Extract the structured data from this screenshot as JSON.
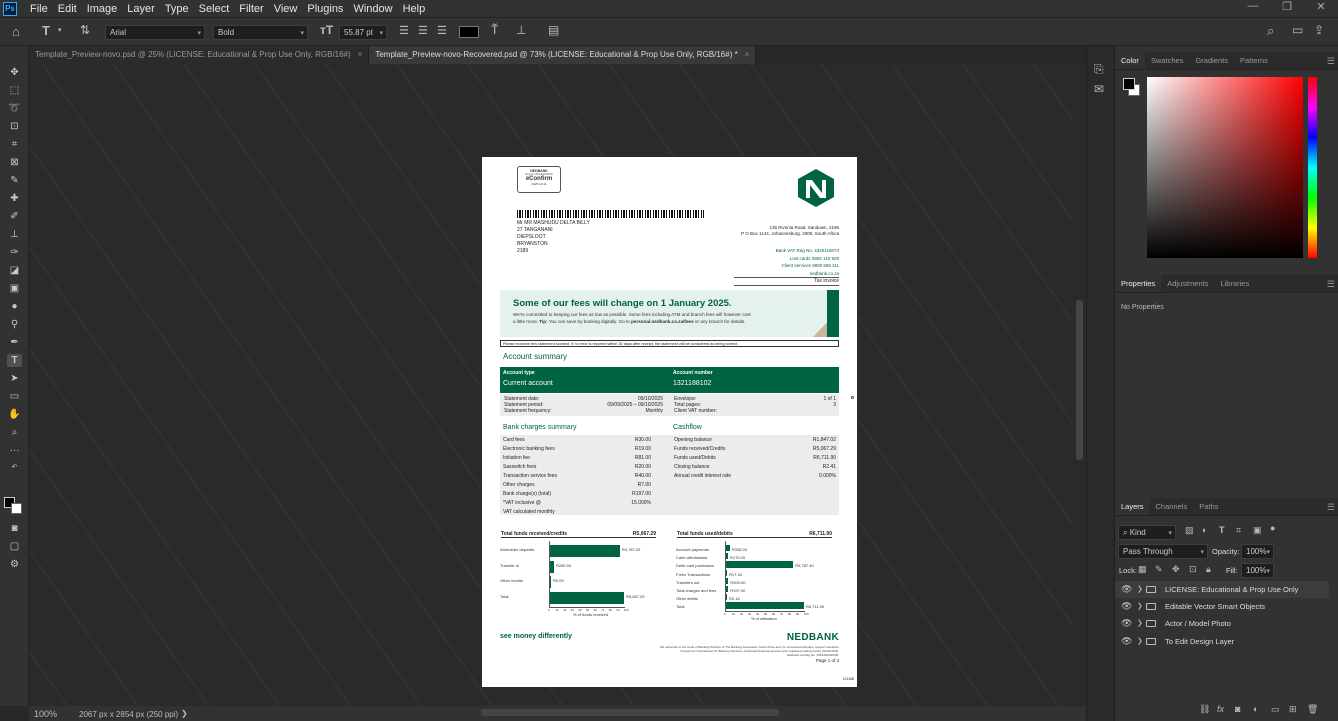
{
  "app": {
    "logo": "Ps"
  },
  "menu": [
    "File",
    "Edit",
    "Image",
    "Layer",
    "Type",
    "Select",
    "Filter",
    "View",
    "Plugins",
    "Window",
    "Help"
  ],
  "options": {
    "font_family": "Arial",
    "font_style": "Bold",
    "font_size": "55.87 pt",
    "color_swatch": "#000000"
  },
  "tabs": [
    {
      "label": "Template_Preview-novo.psd @ 25% (LICENSE: Educational & Prop Use Only, RGB/16#)",
      "close": "×",
      "active": false
    },
    {
      "label": "Template_Preview-novo-Recovered.psd @ 73% (LICENSE: Educational & Prop Use Only, RGB/16#) *",
      "close": "×",
      "active": true
    }
  ],
  "watermark": "Digital Design Awards",
  "status": {
    "zoom": "100%",
    "doc_info": "2067 px x 2854 px (250 ppi)",
    "arrow": "❯"
  },
  "panels": {
    "color_tabs": [
      "Color",
      "Swatches",
      "Gradients",
      "Patterns"
    ],
    "props_tabs": [
      "Properties",
      "Adjustments",
      "Libraries"
    ],
    "props_text": "No Properties",
    "layer_tabs": [
      "Layers",
      "Channels",
      "Paths"
    ],
    "kind": "Kind",
    "blend_mode": "Pass Through",
    "opacity_label": "Opacity:",
    "opacity": "100%",
    "lock_label": "Lock:",
    "fill_label": "Fill:",
    "fill": "100%",
    "layers": [
      "LICENSE: Educational & Prop Use Only",
      "Editable Vector Smart Objects",
      "Actor / Model Photo",
      "To Edit Design Layer"
    ],
    "brand_green": "#006341"
  },
  "document": {
    "stamp_bank": "NEDBANK",
    "stamp_sub": "Reg No 1951/000009/06",
    "stamp_title": "eConfirm",
    "stamp_date": "2025.10.11",
    "address": [
      "Mr MR MASHUDU DELTA BILLY",
      "27 TANGANANI",
      "DIEPSLOOT",
      "BRYANSTON",
      "2189"
    ],
    "bank_address": [
      "135 Rivonia Road, Sandown, 2196",
      "P O Box 1144, Johannesburg, 2000, South Africa"
    ],
    "bank_contacts": [
      "Bank VAT Reg No. 4320116074",
      "Lost cards 0800 110 929",
      "Client services 0800 555 111",
      "nedbank.co.za"
    ],
    "tax_invoice": "Tax invoice",
    "banner_title": "Some of our fees will change on 1 January 2025.",
    "banner_line1": "We're committed to keeping our fees as low as possible. Some fees including ATM and branch fees will however cost",
    "banner_line2_a": "a little more. ",
    "banner_tip": "Tip:",
    "banner_line2_b": " You can save by banking digitally. Go to ",
    "banner_link": "personal.nedbank.co.za/fees",
    "banner_line2_c": " or any branch for details.",
    "notice": "Please examine this statement soonest. If no error is reported within 30 days after receipt, the statement will be considered as being correct.",
    "account_summary": "Account summary",
    "account_type_label": "Account type",
    "account_type": "Current account",
    "account_number_label": "Account number",
    "account_number": "1321188102",
    "stmt_left": [
      [
        "Statement date:",
        "09/10/2025"
      ],
      [
        "Statement period:",
        "09/09/2025 – 09/10/2025"
      ],
      [
        "Statement frequency:",
        "Monthly"
      ]
    ],
    "stmt_right": [
      [
        "Envelope:",
        "1 of 1"
      ],
      [
        "Total pages:",
        "3"
      ],
      [
        "Client VAT number:",
        ""
      ]
    ],
    "charges_title": "Bank charges summary",
    "charges": [
      [
        "Card fees",
        "R30.00"
      ],
      [
        "Electronic banking fees",
        "R19.00"
      ],
      [
        "Initiation fee",
        "R81.00"
      ],
      [
        "Sasswitch fees",
        "R20.00"
      ],
      [
        "Transaction service fees",
        "R40.00"
      ],
      [
        "Other charges",
        "R7.00"
      ],
      [
        "Bank charge(s) (total)",
        "R197.00"
      ],
      [
        "*VAT inclusive @",
        "15.000%"
      ],
      [
        "VAT calculated monthly",
        ""
      ]
    ],
    "cashflow_title": "Cashflow",
    "cashflow": [
      [
        "Opening balance",
        "R1,847.02"
      ],
      [
        "Funds received/Credits",
        "R5,067.29"
      ],
      [
        "Funds used/Debits",
        "R6,711.90"
      ],
      [
        "Closing balance",
        "R2.41"
      ],
      [
        "Annual credit interest rate",
        "0.000%"
      ]
    ],
    "credits_title": "Total funds received/credits",
    "credits_total": "R5,067.29",
    "credits_axis": "% of funds received",
    "debits_title": "Total funds used/debits",
    "debits_total": "R6,711.90",
    "debits_axis": "% of utilisation",
    "slogan": "see money differently",
    "brand": "NEDBANK",
    "footer_lines": [
      "We subscribe to the Code of Banking Practice of The Banking Association South Africa and, for unresolved disputes, support resolution",
      "through the Ombudsman for Banking Services. Authorised financial services and registered credit provider (NCRCP16).",
      "Nedbank Ltd Reg No. 1951/000009/06."
    ],
    "page": "Page 1 of 3",
    "code": "121168"
  },
  "chart_data": [
    {
      "type": "bar",
      "title": "Total funds received/credits",
      "xlabel": "% of funds received",
      "categories": [
        "Atmholder deposits",
        "Transfer in",
        "Other credits",
        "Total"
      ],
      "values": [
        4787.29,
        280.0,
        0.0,
        5067.29
      ],
      "labels": [
        "R4,787.29",
        "R280.00",
        "R0.00",
        "R5,067.29"
      ],
      "xlim": [
        0,
        100
      ],
      "ticks": [
        "0",
        "10",
        "20",
        "30",
        "40",
        "50",
        "60",
        "70",
        "80",
        "90",
        "100"
      ]
    },
    {
      "type": "bar",
      "title": "Total funds used/debits",
      "xlabel": "% of utilisation",
      "categories": [
        "Account payments",
        "Cash withdrawals",
        "Debit card purchases",
        "Forex Transactions",
        "Transfers out",
        "Total charges and fees",
        "Other debits",
        "Total"
      ],
      "values": [
        338.0,
        170.0,
        5787.4,
        17.34,
        200.0,
        197.0,
        2.16,
        6711.9
      ],
      "labels": [
        "R338.00",
        "R170.00",
        "R5,787.40",
        "R17.34",
        "R200.00",
        "R197.00",
        "R2.16",
        "R6,711.90"
      ],
      "xlim": [
        0,
        100
      ],
      "ticks": [
        "0",
        "10",
        "20",
        "30",
        "40",
        "50",
        "60",
        "70",
        "80",
        "90",
        "100"
      ]
    }
  ]
}
